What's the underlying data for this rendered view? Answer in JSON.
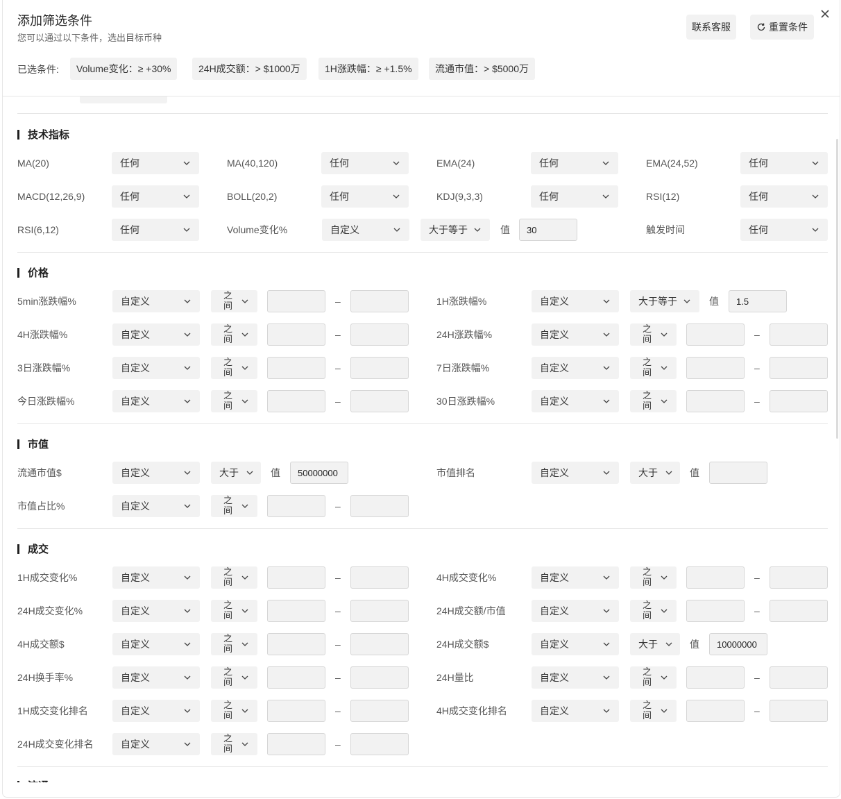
{
  "header": {
    "title": "添加筛选条件",
    "subtitle": "您可以通过以下条件，选出目标币种",
    "support_button": "联系客服",
    "reset_button": "重置条件",
    "selected_label": "已选条件:",
    "chips": [
      "Volume变化：≥ +30%",
      "24H成交额：> $1000万",
      "1H涨跌幅：≥ +1.5%",
      "流通市值：> $5000万"
    ]
  },
  "sections": {
    "tech": {
      "title": "技术指标"
    },
    "price": {
      "title": "价格"
    },
    "cap": {
      "title": "市值"
    },
    "volume": {
      "title": "成交"
    },
    "circulation": {
      "title": "流通"
    }
  },
  "common": {
    "any": "任何",
    "custom": "自定义",
    "between": "之间",
    "gte": "大于等于",
    "gt": "大于",
    "value": "值",
    "dash": "–"
  },
  "tech_rows": [
    [
      {
        "label": "MA(20)",
        "option": "任何"
      },
      {
        "label": "MA(40,120)",
        "option": "任何"
      },
      {
        "label": "EMA(24)",
        "option": "任何"
      },
      {
        "label": "EMA(24,52)",
        "option": "任何"
      }
    ],
    [
      {
        "label": "MACD(12,26,9)",
        "option": "任何"
      },
      {
        "label": "BOLL(20,2)",
        "option": "任何"
      },
      {
        "label": "KDJ(9,3,3)",
        "option": "任何"
      },
      {
        "label": "RSI(12)",
        "option": "任何"
      }
    ]
  ],
  "tech_row3": {
    "rsi_label": "RSI(6,12)",
    "rsi_option": "任何",
    "volume_label": "Volume变化%",
    "volume_option": "自定义",
    "volume_op": "大于等于",
    "volume_value": "30",
    "trigger_label": "触发时间",
    "trigger_option": "任何"
  },
  "price_rows": [
    {
      "label": "5min涨跌幅%",
      "option": "自定义",
      "op": "之间"
    },
    {
      "label": "1H涨跌幅%",
      "option": "自定义",
      "op": "大于等于",
      "value": "1.5"
    },
    {
      "label": "4H涨跌幅%",
      "option": "自定义",
      "op": "之间"
    },
    {
      "label": "24H涨跌幅%",
      "option": "自定义",
      "op": "之间"
    },
    {
      "label": "3日涨跌幅%",
      "option": "自定义",
      "op": "之间"
    },
    {
      "label": "7日涨跌幅%",
      "option": "自定义",
      "op": "之间"
    },
    {
      "label": "今日涨跌幅%",
      "option": "自定义",
      "op": "之间"
    },
    {
      "label": "30日涨跌幅%",
      "option": "自定义",
      "op": "之间"
    }
  ],
  "cap_rows": [
    {
      "label": "流通市值$",
      "option": "自定义",
      "op": "大于",
      "value": "50000000"
    },
    {
      "label": "市值排名",
      "option": "自定义",
      "op": "大于",
      "value": ""
    },
    {
      "label": "市值占比%",
      "option": "自定义",
      "op": "之间"
    }
  ],
  "volume_rows": [
    {
      "label": "1H成交变化%",
      "option": "自定义",
      "op": "之间"
    },
    {
      "label": "4H成交变化%",
      "option": "自定义",
      "op": "之间"
    },
    {
      "label": "24H成交变化%",
      "option": "自定义",
      "op": "之间"
    },
    {
      "label": "24H成交额/市值",
      "option": "自定义",
      "op": "之间"
    },
    {
      "label": "4H成交额$",
      "option": "自定义",
      "op": "之间"
    },
    {
      "label": "24H成交额$",
      "option": "自定义",
      "op": "大于",
      "value": "10000000"
    },
    {
      "label": "24H换手率%",
      "option": "自定义",
      "op": "之间"
    },
    {
      "label": "24H量比",
      "option": "自定义",
      "op": "之间"
    },
    {
      "label": "1H成交变化排名",
      "option": "自定义",
      "op": "之间"
    },
    {
      "label": "4H成交变化排名",
      "option": "自定义",
      "op": "之间"
    },
    {
      "label": "24H成交变化排名",
      "option": "自定义",
      "op": "之间"
    }
  ]
}
